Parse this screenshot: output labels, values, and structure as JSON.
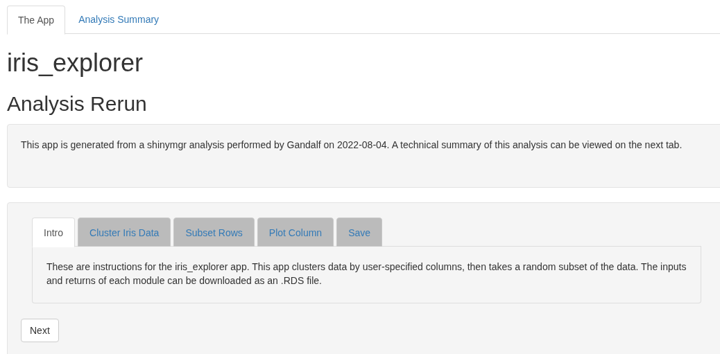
{
  "top_tabs": [
    {
      "label": "The App",
      "selected": true
    },
    {
      "label": "Analysis Summary",
      "selected": false
    }
  ],
  "title": "iris_explorer",
  "subtitle": "Analysis Rerun",
  "info": "This app is generated from a shinymgr analysis performed by Gandalf on 2022-08-04. A technical summary of this analysis can be viewed on the next tab.",
  "module_tabs": [
    {
      "label": "Intro",
      "selected": true
    },
    {
      "label": "Cluster Iris Data",
      "selected": false
    },
    {
      "label": "Subset Rows",
      "selected": false
    },
    {
      "label": "Plot Column",
      "selected": false
    },
    {
      "label": "Save",
      "selected": false
    }
  ],
  "module_text": "These are instructions for the iris_explorer app. This app clusters data by user-specified columns, then takes a random subset of the data. The inputs and returns of each module can be downloaded as an .RDS file.",
  "buttons": [
    "Next"
  ]
}
